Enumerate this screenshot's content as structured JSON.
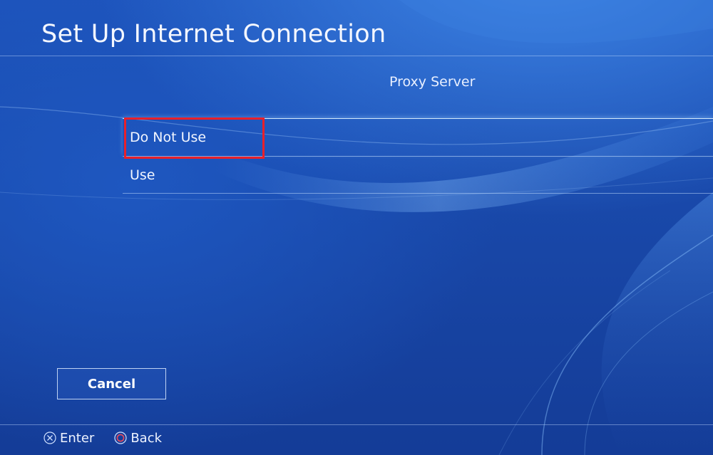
{
  "header": {
    "title": "Set Up Internet Connection"
  },
  "section": {
    "label": "Proxy Server"
  },
  "options": [
    {
      "label": "Do Not Use",
      "selected": true
    },
    {
      "label": "Use",
      "selected": false
    }
  ],
  "actions": {
    "cancel_label": "Cancel"
  },
  "footer": {
    "enter_label": "Enter",
    "enter_icon": "cross-button-icon",
    "back_label": "Back",
    "back_icon": "circle-button-icon"
  },
  "colors": {
    "background": "#1a4aa8",
    "highlight": "#e8202a",
    "back_icon": "#e84a5a"
  }
}
